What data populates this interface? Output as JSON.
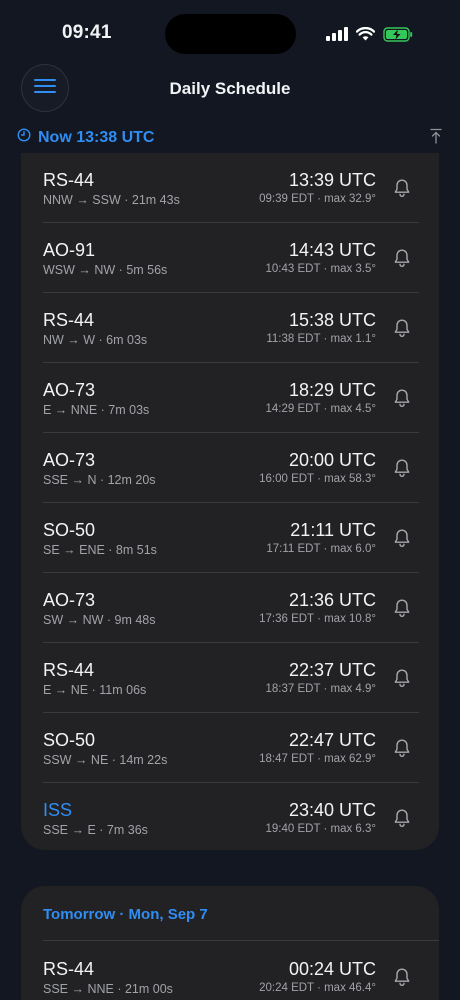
{
  "status_bar": {
    "time": "09:41"
  },
  "header": {
    "title": "Daily Schedule",
    "menu_icon": "hamburger-icon"
  },
  "now_marker": {
    "label": "Now 13:38 UTC",
    "icon": "clock-icon",
    "scroll_top_icon": "scroll-to-top-icon"
  },
  "today": {
    "passes": [
      {
        "satellite": "RS-44",
        "direction": "NNW → SSW · 21m 43s",
        "utc": "13:39 UTC",
        "local": "09:39 EDT · max 32.9°"
      },
      {
        "satellite": "AO-91",
        "direction": "WSW → NW · 5m 56s",
        "utc": "14:43 UTC",
        "local": "10:43 EDT · max 3.5°"
      },
      {
        "satellite": "RS-44",
        "direction": "NW → W · 6m 03s",
        "utc": "15:38 UTC",
        "local": "11:38 EDT · max 1.1°"
      },
      {
        "satellite": "AO-73",
        "direction": "E → NNE · 7m 03s",
        "utc": "18:29 UTC",
        "local": "14:29 EDT · max 4.5°"
      },
      {
        "satellite": "AO-73",
        "direction": "SSE → N · 12m 20s",
        "utc": "20:00 UTC",
        "local": "16:00 EDT · max 58.3°"
      },
      {
        "satellite": "SO-50",
        "direction": "SE → ENE · 8m 51s",
        "utc": "21:11 UTC",
        "local": "17:11 EDT · max 6.0°"
      },
      {
        "satellite": "AO-73",
        "direction": "SW → NW · 9m 48s",
        "utc": "21:36 UTC",
        "local": "17:36 EDT · max 10.8°"
      },
      {
        "satellite": "RS-44",
        "direction": "E → NE · 11m 06s",
        "utc": "22:37 UTC",
        "local": "18:37 EDT · max 4.9°"
      },
      {
        "satellite": "SO-50",
        "direction": "SSW → NE · 14m 22s",
        "utc": "22:47 UTC",
        "local": "18:47 EDT · max 62.9°"
      },
      {
        "satellite": "ISS",
        "direction": "SSE → E · 7m 36s",
        "utc": "23:40 UTC",
        "local": "19:40 EDT · max 6.3°",
        "highlight": true
      }
    ]
  },
  "tomorrow": {
    "header": "Tomorrow · Mon, Sep 7",
    "passes": [
      {
        "satellite": "RS-44",
        "direction": "SSE → NNE · 21m 00s",
        "utc": "00:24 UTC",
        "local": "20:24 EDT · max 46.4°"
      }
    ]
  },
  "colors": {
    "accent": "#2f8df4",
    "background": "#121722",
    "card": "#222224",
    "battery": "#34c759"
  }
}
